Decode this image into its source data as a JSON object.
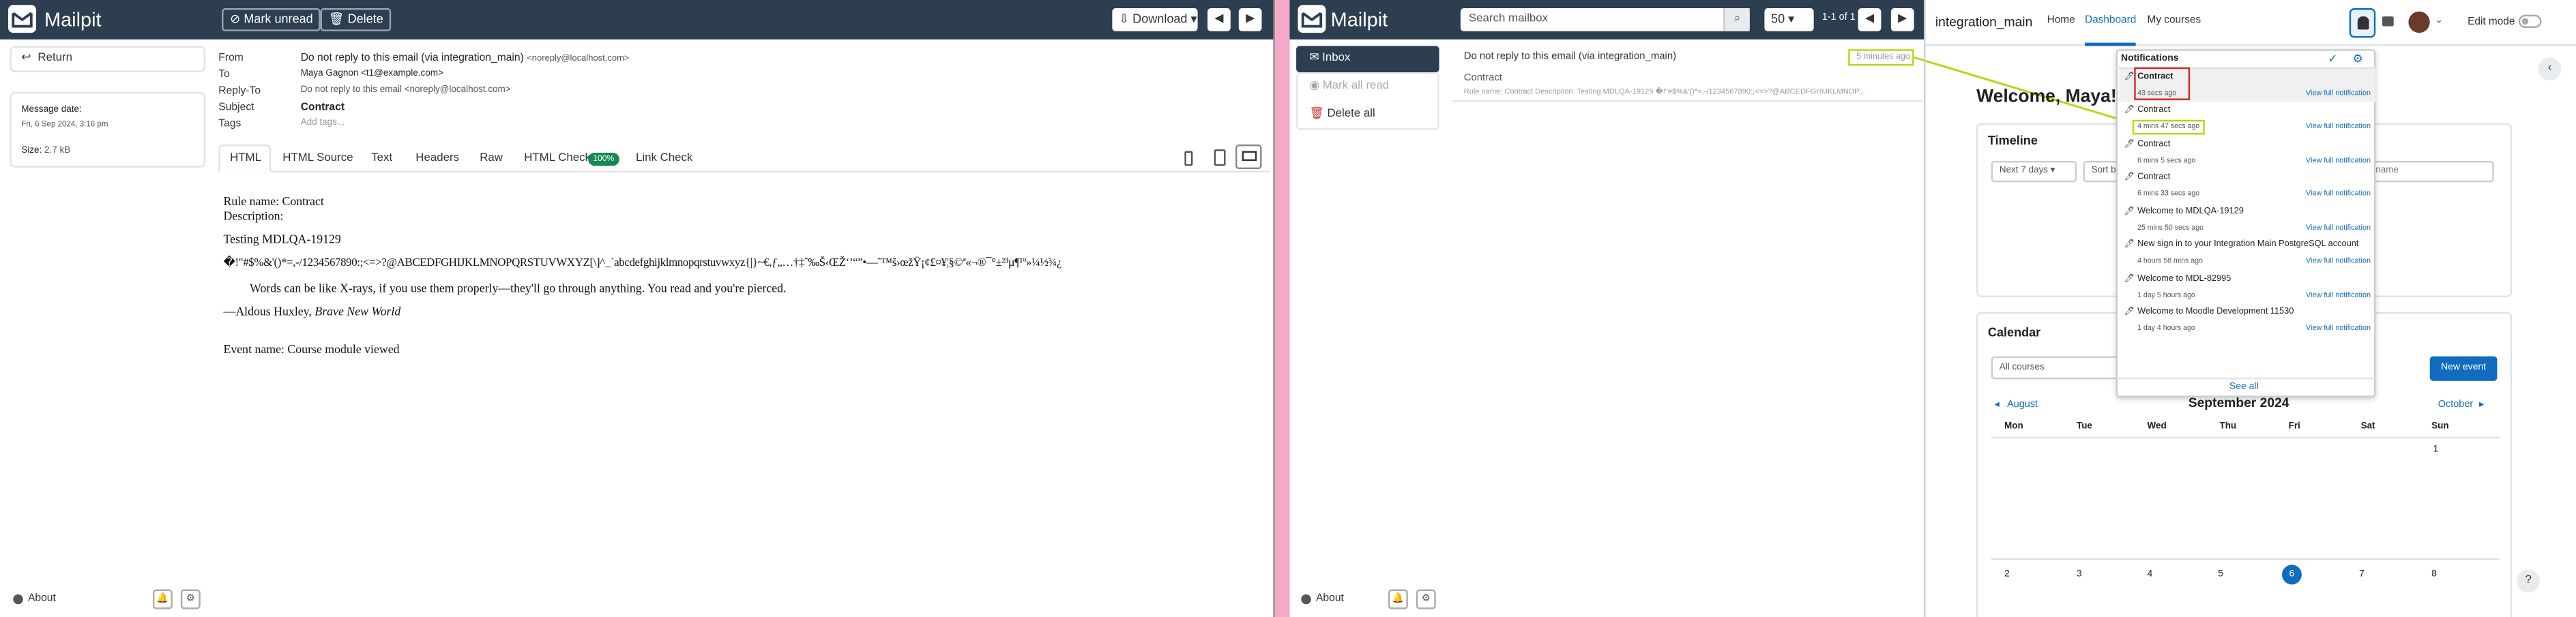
{
  "colors": {
    "mailpit_nav": "#2c3e50",
    "pink_strip": "#f5a9c8",
    "moodle_blue": "#0f6cbf",
    "highlight_red": "#d9251f",
    "highlight_green": "#b5d80f"
  },
  "left_pane": {
    "brand": "Mailpit",
    "toolbar": {
      "mark_unread": "Mark unread",
      "delete": "Delete",
      "download": "Download",
      "prev_icon": "chevron-left-icon",
      "next_icon": "chevron-right-icon"
    },
    "return_label": "Return",
    "message_date_label": "Message date:",
    "message_date": "Fri, 6 Sep 2024, 3:16 pm",
    "size_label": "Size:",
    "size_value": "2.7 kB",
    "headers": {
      "from_label": "From",
      "from_name": "Do not reply to this email  (via integration_main)",
      "from_email": "<noreply@localhost.com>",
      "to_label": "To",
      "to_value": "Maya Gagnon <t1@example.com>",
      "replyto_label": "Reply-To",
      "replyto_value": "Do not reply to this email <noreply@localhost.com>",
      "subject_label": "Subject",
      "subject_value": "Contract",
      "tags_label": "Tags",
      "tags_placeholder": "Add tags..."
    },
    "tabs": [
      "HTML",
      "HTML Source",
      "Text",
      "Headers",
      "Raw",
      "HTML Check",
      "Link Check"
    ],
    "html_check_badge": "100%",
    "body": {
      "line1": "Rule name: Contract",
      "line2": "Description:",
      "line3": "Testing MDLQA-19129",
      "line4": "�!\"#$%&'()*=,-/1234567890:;<=>?@ABCEDFGHIJKLMNOPQRSTUVWXYZ[\\]^_`abcdefghijklmnopqrstuvwxyz{|}~€,ƒ„…†‡ˆ‰Š‹ŒŽ‘’“”•—˜™š›œžŸ¡¢£¤¥¦§©ª«¬®¯°±²³µ¶¹º»¼½¾¿",
      "quote": "Words can be like X-rays, if you use them properly—they'll go through anything. You read and you're pierced.",
      "attribution_prefix": "—Aldous Huxley, ",
      "attribution_book": "Brave New World",
      "event": "Event name: Course module viewed"
    },
    "about": "About"
  },
  "middle_pane": {
    "brand": "Mailpit",
    "search_placeholder": "Search mailbox",
    "per_page": "50",
    "pagination": "1-1 of 1",
    "menu": {
      "inbox": "Inbox",
      "mark_all_read": "Mark all read",
      "delete_all": "Delete all"
    },
    "message": {
      "from": "Do not reply to this email (via integration_main)",
      "age": "5 minutes ago",
      "subject": "Contract",
      "snippet": "Rule name: Contract Description: Testing MDLQA-19129 �!\"#$%&'()*=,-/1234567890:;<=>?@ABCEDFGHIJKLMNOP..."
    },
    "about": "About"
  },
  "moodle": {
    "site_name": "integration_main",
    "nav": [
      "Home",
      "Dashboard",
      "My courses"
    ],
    "edit_mode": "Edit mode",
    "welcome": "Welcome, Maya!",
    "timeline": {
      "title": "Timeline",
      "filter": "Next 7 days",
      "sort": "Sort b",
      "search_placeholder": "name"
    },
    "calendar": {
      "title": "Calendar",
      "courses_select": "All courses",
      "new_event": "New event",
      "prev": "August",
      "month": "September 2024",
      "next": "October",
      "weekdays": [
        "Mon",
        "Tue",
        "Wed",
        "Thu",
        "Fri",
        "Sat",
        "Sun"
      ],
      "week1_sun": "1",
      "week2": [
        "2",
        "3",
        "4",
        "5",
        "6",
        "7",
        "8"
      ],
      "today": "6"
    },
    "notifications": {
      "title": "Notifications",
      "items": [
        {
          "title": "Contract",
          "time": "43 secs ago",
          "link": "View full notification"
        },
        {
          "title": "Contract",
          "time": "4 mins 47 secs ago",
          "link": "View full notification"
        },
        {
          "title": "Contract",
          "time": "6 mins 5 secs ago",
          "link": "View full notification"
        },
        {
          "title": "Contract",
          "time": "6 mins 33 secs ago",
          "link": "View full notification"
        },
        {
          "title": "Welcome to MDLQA-19129",
          "time": "25 mins 50 secs ago",
          "link": "View full notification"
        },
        {
          "title": "New sign in to your Integration Main PostgreSQL account",
          "time": "4 hours 58 mins ago",
          "link": "View full notification"
        },
        {
          "title": "Welcome to MDL-82995",
          "time": "1 day 5 hours ago",
          "link": "View full notification"
        },
        {
          "title": "Welcome to Moodle Development 11530",
          "time": "1 day 4 hours ago",
          "link": "View full notification"
        }
      ],
      "see_all": "See all"
    },
    "help": "?"
  }
}
